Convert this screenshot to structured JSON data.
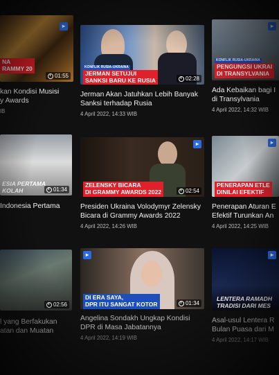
{
  "videos": [
    {
      "title": "kan Kondisi Musisi\ny Awards",
      "date": "IB",
      "chip": "NA\nRAMMY 20",
      "small_chip": "",
      "duration": "01:55",
      "logo": "▸"
    },
    {
      "title": "Jerman Akan Jatuhkan Lebih Banyak\nSanksi terhadap Rusia",
      "date": "4 April 2022, 14:33 WIB",
      "chip": "JERMAN SETUJUI\nSANKSI BARU KE RUSIA",
      "small_chip": "KONFLIK RUSIA-UKRAINA",
      "duration": "02:28",
      "logo": "▸"
    },
    {
      "title": "Ada Kebaikan bagi I\ndi Transylvania",
      "date": "4 April 2022, 14:32 WIB",
      "chip": "PENGUNGSI UKRAI\nDI TRANSYLVANIA",
      "small_chip": "KONFLIK RUSIA-UKRAINA",
      "duration": "",
      "logo": "▸"
    },
    {
      "title": "Indonesia Pertama",
      "date": "",
      "chip": "ESIA PERTAMA\nKOLAH",
      "small_chip": "",
      "duration": "01:34",
      "logo": ""
    },
    {
      "title": "Presiden Ukraina Volodymyr Zelensky\nBicara di Grammy Awards 2022",
      "date": "4 April 2022, 14:26 WIB",
      "chip": "ZELENSKY BICARA\nDI GRAMMY AWARDS 2022",
      "small_chip": "",
      "duration": "02:54",
      "logo": "▸"
    },
    {
      "title": "Penerapan Aturan E\nEfektif Turunkan An",
      "date": "4 April 2022, 14:25 WIB",
      "chip": "PENERAPAN ETLE\nDINILAI EFEKTIF",
      "small_chip": "",
      "duration": "",
      "logo": "▸"
    },
    {
      "title": "l yang Berfakukan\natan dan Muatan",
      "date": "",
      "chip": "",
      "small_chip": "",
      "duration": "02:56",
      "logo": ""
    },
    {
      "title": "Angelina Sondakh Ungkap Kondisi\nDPR di Masa Jabatannya",
      "date": "4 April 2022, 14:19 WIB",
      "chip": "DI ERA SAYA,\nDPR ITU SANGAT KOTOR",
      "small_chip": "",
      "duration": "01:34",
      "logo": "▸"
    },
    {
      "title": "Asal-usul Lentera R\nBulan Puasa dari M",
      "date": "4 April 2022, 14:17 WIB",
      "chip": "LENTERA RAMADH\nTRADISI DARI MES",
      "small_chip": "",
      "duration": "",
      "logo": "▸"
    }
  ]
}
